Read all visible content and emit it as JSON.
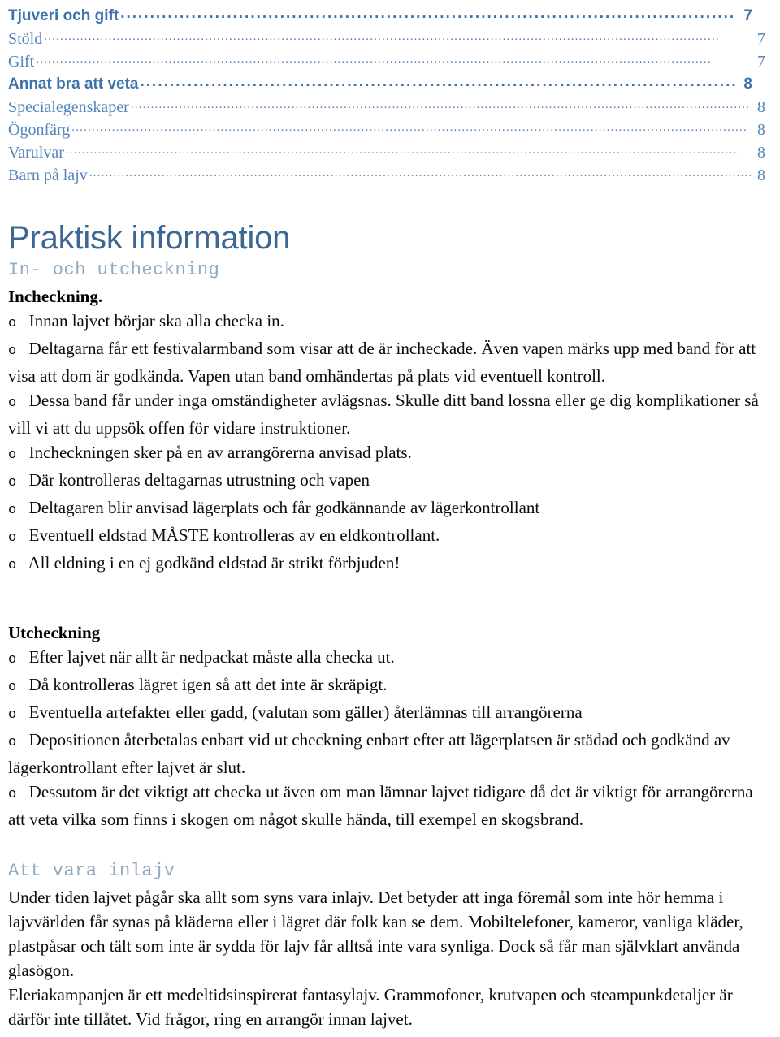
{
  "toc": {
    "entries": [
      {
        "label": "Tjuveri och gift",
        "page": "7",
        "level": 1
      },
      {
        "label": "Stöld",
        "page": "7",
        "level": 2
      },
      {
        "label": "Gift",
        "page": "7",
        "level": 2
      },
      {
        "label": "Annat bra att veta",
        "page": "8",
        "level": 1
      },
      {
        "label": "Specialegenskaper",
        "page": "8",
        "level": 2
      },
      {
        "label": "Ögonfärg",
        "page": "8",
        "level": 2
      },
      {
        "label": "Varulvar",
        "page": "8",
        "level": 2
      },
      {
        "label": "Barn på lajv",
        "page": "8",
        "level": 2
      }
    ]
  },
  "section": {
    "title": "Praktisk information",
    "subheading_checkin": "In- och utcheckning",
    "subheading_inlajv": "Att vara inlajv"
  },
  "checkin": {
    "heading": "Incheckning.",
    "bullet_mark": "o",
    "items": [
      "Innan lajvet börjar ska alla checka in.",
      "Deltagarna får ett festivalarmband som visar att de är incheckade. Även vapen märks upp med band för att visa att dom är godkända. Vapen utan band omhändertas på plats vid eventuell kontroll.",
      "Dessa band får under inga omständigheter avlägsnas. Skulle ditt band lossna eller ge dig komplikationer så vill vi att du uppsök offen för vidare instruktioner.",
      "Incheckningen sker på en av arrangörerna anvisad plats.",
      "Där kontrolleras deltagarnas utrustning och vapen",
      "Deltagaren blir anvisad lägerplats och får godkännande av lägerkontrollant",
      "Eventuell eldstad MÅSTE kontrolleras av en eldkontrollant.",
      "All eldning i en ej godkänd eldstad är strikt förbjuden!"
    ]
  },
  "checkout": {
    "heading": "Utcheckning",
    "bullet_mark": "o",
    "items": [
      "Efter lajvet när allt är nedpackat måste alla checka ut.",
      "Då kontrolleras lägret igen så att det inte är skräpigt.",
      "Eventuella artefakter eller gadd, (valutan som gäller) återlämnas till arrangörerna",
      "Depositionen återbetalas enbart vid ut checkning enbart efter att lägerplatsen är städad och godkänd av lägerkontrollant efter lajvet är slut.",
      "Dessutom är det viktigt att checka ut även om man lämnar lajvet tidigare då det är viktigt för arrangörerna att veta vilka som finns i skogen om något skulle hända, till exempel en skogsbrand."
    ]
  },
  "inlajv": {
    "paragraphs": [
      "Under tiden lajvet pågår ska allt som syns vara inlajv. Det betyder att inga föremål som inte hör hemma i lajvvärlden får synas på kläderna eller i lägret där folk kan se dem. Mobiltelefoner, kameror, vanliga kläder, plastpåsar och tält som inte är sydda för lajv får alltså inte vara synliga. Dock så får man självklart använda glasögon.",
      "Eleriakampanjen är ett medeltidsinspirerat fantasylajv. Grammofoner, krutvapen och steampunkdetaljer är därför inte tillåtet. Vid frågor, ring en arrangör innan lajvet."
    ]
  },
  "colors": {
    "toc_level1": "#3d73ab",
    "toc_level2": "#5585bb",
    "title": "#3c6792",
    "mono_subheading": "#93aac2",
    "body": "#0a0a0a"
  }
}
